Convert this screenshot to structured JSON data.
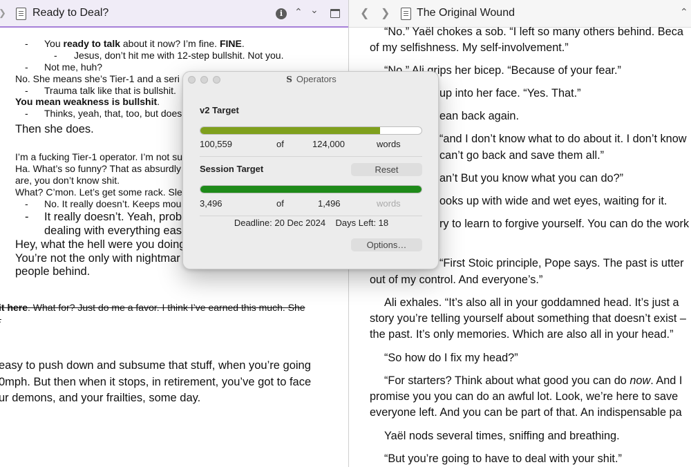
{
  "left": {
    "title": "Ready to Deal?",
    "lines": [
      {
        "bullet": "-",
        "segments": [
          {
            "t": "You "
          },
          {
            "t": "ready to talk",
            "b": true
          },
          {
            "t": " about it now? I’m fine. "
          },
          {
            "t": "FINE",
            "b": true
          },
          {
            "t": "."
          }
        ]
      },
      {
        "bullet": "-",
        "segments": [
          {
            "t": "Jesus, don’t hit me with 12-step bullshit. Not you."
          }
        ]
      },
      {
        "bullet": "-",
        "segments": [
          {
            "t": "Not me, huh?"
          }
        ]
      },
      {
        "segments": [
          {
            "t": "No. She means she’s Tier-1 and a seri"
          }
        ]
      },
      {
        "bullet": "-",
        "segments": [
          {
            "t": "Trauma talk like that is bullshit."
          }
        ]
      },
      {
        "segments": [
          {
            "t": "You mean weakness is bullshit",
            "b": true
          },
          {
            "t": "."
          }
        ]
      },
      {
        "bullet": "-",
        "segments": [
          {
            "t": "Thinks, yeah, that, too, but does"
          }
        ]
      },
      {
        "segments": [
          {
            "t": "Then she does."
          }
        ]
      },
      {
        "segments": [
          {
            "t": "I’m a fucking Tier-1 operator. I’m not su"
          }
        ]
      },
      {
        "segments": [
          {
            "t": "Ha. What’s so funny? That as absurdly"
          }
        ]
      },
      {
        "segments": [
          {
            "t": "are, you don’t know shit."
          }
        ]
      },
      {
        "segments": [
          {
            "t": "What? C’mon. Let’s get some rack. Sle"
          }
        ]
      },
      {
        "bullet": "-",
        "segments": [
          {
            "t": "No. It really doesn’t. Keeps mou"
          }
        ]
      },
      {
        "bullet": "-",
        "segments": [
          {
            "t": "It really doesn’t. Yeah, prob"
          }
        ]
      },
      {
        "segments": [
          {
            "t": "dealing with everything eas"
          }
        ]
      },
      {
        "segments": [
          {
            "t": "Hey, what the hell were you doing"
          }
        ]
      },
      {
        "segments": [
          {
            "t": "You’re not the only with nightmar"
          }
        ]
      },
      {
        "segments": [
          {
            "t": "people behind."
          }
        ]
      },
      {
        "segments": [
          {
            "t": "it here",
            "b": true
          },
          {
            "t": ". What for? Just do me a favor. I think I’ve earned this much. She"
          }
        ]
      },
      {
        "segments": [
          {
            "t": "."
          }
        ]
      },
      {
        "segments": [
          {
            "t": "easy to push down and subsume that stuff, when you’re going"
          }
        ]
      },
      {
        "segments": [
          {
            "t": "0mph. But then when it stops, in retirement, you’ve got to face"
          }
        ]
      },
      {
        "segments": [
          {
            "t": "ur demons, and your frailties, some day."
          }
        ]
      }
    ]
  },
  "right": {
    "title": "The Original Wound",
    "lines": [
      {
        "segments": [
          {
            "t": "“No.” Yaël chokes a sob. “I left so many others behind. Beca"
          }
        ]
      },
      {
        "segments": [
          {
            "t": "of my selfishness. My self-involvement.”"
          }
        ]
      },
      {
        "segments": [
          {
            "t": "“No.” Ali grips her bicep. “Because of your fear.”"
          }
        ]
      },
      {
        "segments": [
          {
            "t": "up into her face. “Yes. That.”"
          }
        ]
      },
      {
        "segments": [
          {
            "t": "ean back again."
          }
        ]
      },
      {
        "segments": [
          {
            "t": "“and I don’t know what to do about it. I don’t know"
          }
        ]
      },
      {
        "segments": [
          {
            "t": "can’t go back and save them all.”"
          }
        ]
      },
      {
        "segments": [
          {
            "t": "an’t But you know what you can do?”"
          }
        ]
      },
      {
        "segments": [
          {
            "t": "ooks up with wide and wet eyes, waiting for it."
          }
        ]
      },
      {
        "segments": [
          {
            "t": "ry to learn to forgive yourself. You can do the work"
          }
        ]
      },
      {
        "segments": [
          {
            "t": "“First Stoic principle, Pope says. The past is utter"
          }
        ]
      },
      {
        "segments": [
          {
            "t": "out of my control. And everyone’s.”"
          }
        ]
      },
      {
        "segments": [
          {
            "t": "Ali exhales. “It’s also all in your goddamned head. It’s just a"
          }
        ]
      },
      {
        "segments": [
          {
            "t": "story you’re telling yourself about something that doesn’t exist –"
          }
        ]
      },
      {
        "segments": [
          {
            "t": "the past. It’s only memories. Which are also all in your head.”"
          }
        ]
      },
      {
        "segments": [
          {
            "t": "“So how do I fix my head?”"
          }
        ]
      },
      {
        "segments": [
          {
            "t": "“For starters? Think about what good you can do "
          },
          {
            "t": "now",
            "i": true
          },
          {
            "t": ". And I"
          }
        ]
      },
      {
        "segments": [
          {
            "t": "promise you you can do an awful lot. Look, we’re here to save"
          }
        ]
      },
      {
        "segments": [
          {
            "t": "everyone left. And you can be part of that. An indispensable pa"
          }
        ]
      },
      {
        "segments": [
          {
            "t": "Yaël nods several times, sniffing and breathing."
          }
        ]
      },
      {
        "segments": [
          {
            "t": "“But you’re going to have to deal with your shit.”"
          }
        ]
      }
    ]
  },
  "operators": {
    "title": "Operators",
    "logo": "S",
    "v2_label": "v2 Target",
    "v2_current": "100,559",
    "v2_of": "of",
    "v2_target": "124,000",
    "v2_unit": "words",
    "v2_progress": 0.811,
    "session_label": "Session Target",
    "reset_label": "Reset",
    "session_current": "3,496",
    "session_of": "of",
    "session_target": "1,496",
    "session_unit": "words",
    "session_progress": 1.0,
    "deadline": "Deadline: 20 Dec 2024",
    "days_left": "Days Left: 18",
    "options_label": "Options…",
    "v2_color": "#7fa01d",
    "session_color": "#1e8a19"
  }
}
